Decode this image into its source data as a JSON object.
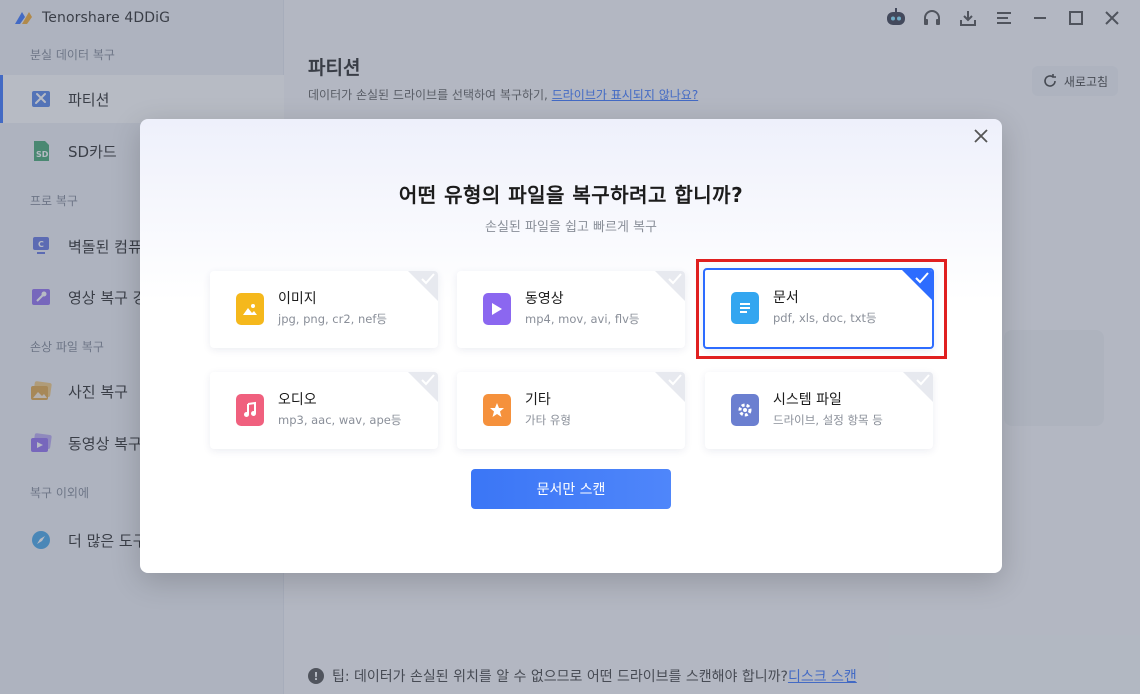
{
  "app": {
    "title": "Tenorshare 4DDiG"
  },
  "sidebar": {
    "sections": [
      {
        "title": "분실 데이터 복구"
      },
      {
        "title": "프로 복구"
      },
      {
        "title": "손상 파일 복구"
      },
      {
        "title": "복구 이외에"
      }
    ],
    "items": [
      {
        "label": "파티션",
        "icon": "partition-tools-icon"
      },
      {
        "label": "SD카드",
        "icon": "sd-card-icon"
      },
      {
        "label": "벽돌된 컴퓨",
        "icon": "computer-icon"
      },
      {
        "label": "영상 복구 강",
        "icon": "video-repair-icon"
      },
      {
        "label": "사진 복구",
        "icon": "photo-icon"
      },
      {
        "label": "동영상 복구",
        "icon": "video-icon"
      },
      {
        "label": "더 많은 도구",
        "icon": "compass-icon"
      }
    ]
  },
  "main": {
    "title": "파티션",
    "subtitle": "데이터가 손실된 드라이브를 선택하여 복구하기,",
    "subtitle_link": "드라이브가 표시되지 않나요?",
    "refresh_label": "새로고침",
    "tip_text": "팁: 데이터가 손실된 위치를 알 수 없으므로 어떤 드라이브를 스캔해야 합니까?",
    "tip_link": "디스크 스캔"
  },
  "modal": {
    "title": "어떤 유형의 파일을 복구하려고 합니까?",
    "subtitle": "손실된 파일을 쉽고 빠르게 복구",
    "scan_button": "문서만 스캔",
    "file_types": [
      {
        "name": "이미지",
        "desc": "jpg, png, cr2, nef등",
        "icon": "image-icon",
        "color": "#f5b81c",
        "selected": false
      },
      {
        "name": "동영상",
        "desc": "mp4, mov, avi, flv등",
        "icon": "play-icon",
        "color": "#8b67f0",
        "selected": false
      },
      {
        "name": "문서",
        "desc": "pdf, xls, doc, txt등",
        "icon": "document-icon",
        "color": "#33a6f0",
        "selected": true
      },
      {
        "name": "오디오",
        "desc": "mp3, aac, wav, ape등",
        "icon": "music-icon",
        "color": "#f0607e",
        "selected": false
      },
      {
        "name": "기타",
        "desc": "가타 유형",
        "icon": "star-icon",
        "color": "#f5913c",
        "selected": false
      },
      {
        "name": "시스템 파일",
        "desc": "드라이브, 설정 항목 등",
        "icon": "gear-icon",
        "color": "#6b7fd0",
        "selected": false
      }
    ]
  },
  "colors": {
    "accent": "#2d6cff",
    "highlight": "#e02020"
  }
}
